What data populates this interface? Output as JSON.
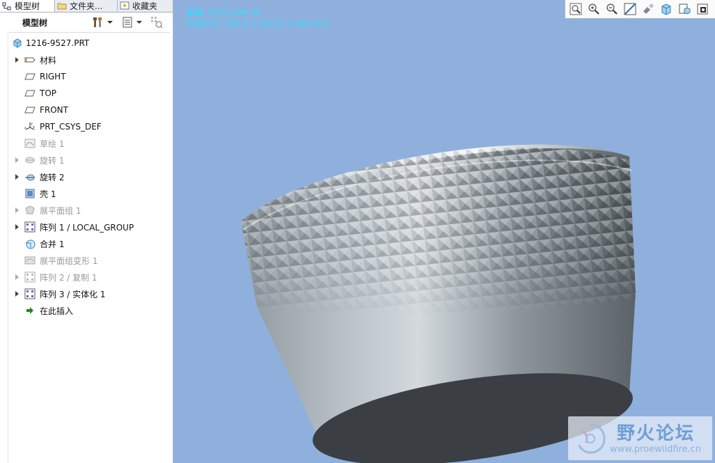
{
  "tabs": [
    {
      "label": "模型树",
      "icon": "model-tree-icon",
      "active": true
    },
    {
      "label": "文件夹...",
      "icon": "folder-icon",
      "active": false
    },
    {
      "label": "收藏夹",
      "icon": "favorites-icon",
      "active": false
    }
  ],
  "toolbar": {
    "title": "模型树",
    "settings_icon": "tools-icon",
    "show_icon": "list-icon",
    "filter_icon": "filter-icon"
  },
  "tree": {
    "root": "1216-9527.PRT",
    "items": [
      {
        "label": "材料",
        "icon": "material-icon",
        "expandable": true,
        "dim": false
      },
      {
        "label": "RIGHT",
        "icon": "datum-plane-icon",
        "expandable": false,
        "dim": false
      },
      {
        "label": "TOP",
        "icon": "datum-plane-icon",
        "expandable": false,
        "dim": false
      },
      {
        "label": "FRONT",
        "icon": "datum-plane-icon",
        "expandable": false,
        "dim": false
      },
      {
        "label": "PRT_CSYS_DEF",
        "icon": "csys-icon",
        "expandable": false,
        "dim": false
      },
      {
        "label": "草绘 1",
        "icon": "sketch-icon",
        "expandable": false,
        "dim": true
      },
      {
        "label": "旋转 1",
        "icon": "revolve-icon",
        "expandable": true,
        "dim": true
      },
      {
        "label": "旋转 2",
        "icon": "revolve-icon",
        "expandable": true,
        "dim": false
      },
      {
        "label": "壳 1",
        "icon": "shell-icon",
        "expandable": false,
        "dim": false
      },
      {
        "label": "展平面组 1",
        "icon": "flatten-quilt-icon",
        "expandable": true,
        "dim": true
      },
      {
        "label": "阵列 1 / LOCAL_GROUP",
        "icon": "pattern-icon",
        "expandable": true,
        "dim": false
      },
      {
        "label": "合并 1",
        "icon": "merge-icon",
        "expandable": false,
        "dim": false
      },
      {
        "label": "展平面组变形 1",
        "icon": "flatten-deform-icon",
        "expandable": false,
        "dim": true
      },
      {
        "label": "阵列 2 / 复制 1",
        "icon": "pattern-icon",
        "expandable": true,
        "dim": true
      },
      {
        "label": "阵列 3 / 实体化 1",
        "icon": "pattern-icon",
        "expandable": true,
        "dim": false
      },
      {
        "label": "在此插入",
        "icon": "insert-here-arrow-icon",
        "expandable": false,
        "dim": false
      }
    ]
  },
  "viewport": {
    "info_line1": "重量: 6372.446 克",
    "info_line2": "外部尺寸: 101.2 x 59.12 x 100 mm",
    "tools": [
      "zoom-fit-icon",
      "zoom-in-icon",
      "zoom-out-icon",
      "repaint-icon",
      "display-style-icon",
      "saved-views-icon",
      "view-manager-icon",
      "spin-center-icon"
    ],
    "watermark_cn": "野火论坛",
    "watermark_en": "www.proewildfire.cn"
  },
  "colors": {
    "background": "#8fb0dd",
    "info_text": "#2ce0ff",
    "model": "#9aa4ab"
  }
}
